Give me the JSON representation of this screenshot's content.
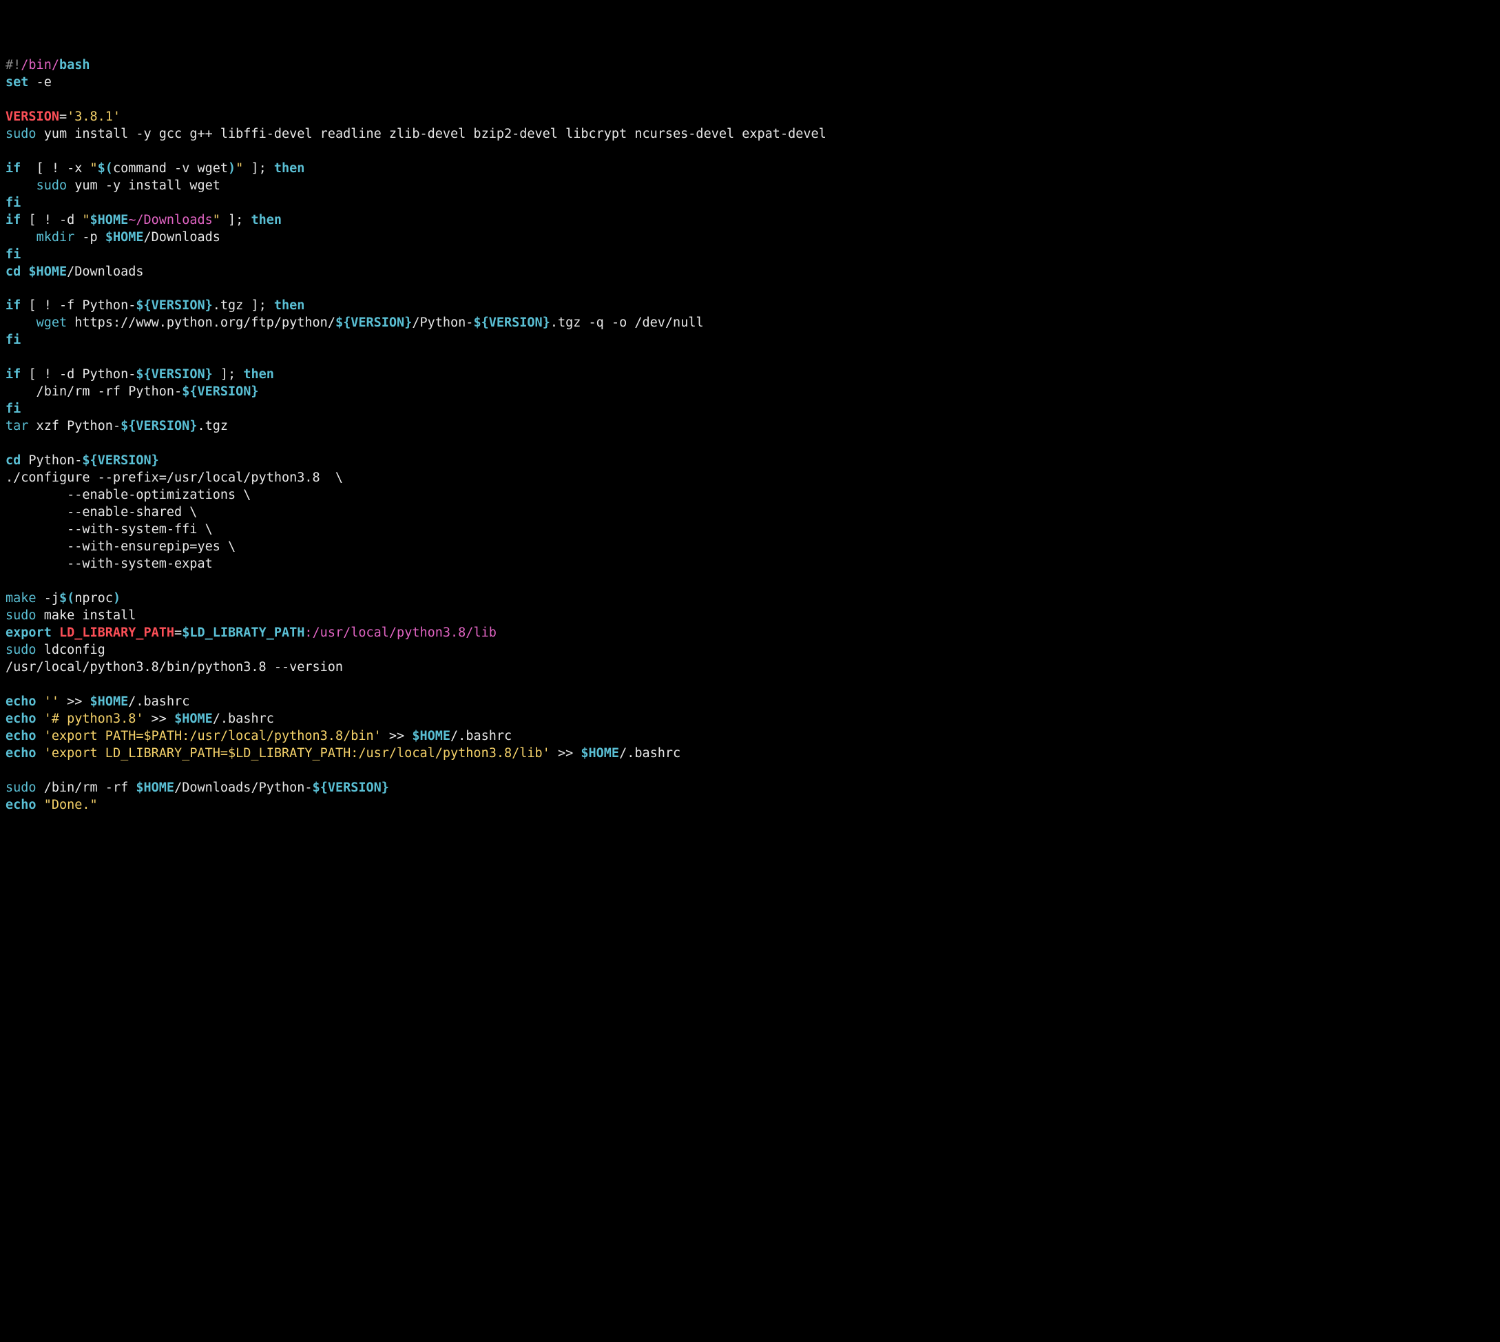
{
  "tokens": [
    {
      "c": "shebang",
      "t": "#!"
    },
    {
      "c": "path",
      "t": "/bin/"
    },
    {
      "c": "cmd bold",
      "t": "bash"
    },
    {
      "nl": true
    },
    {
      "c": "cmd bold",
      "t": "set"
    },
    {
      "c": "arg",
      "t": " -e"
    },
    {
      "nl": true
    },
    {
      "nl": true
    },
    {
      "c": "red bold",
      "t": "VERSION"
    },
    {
      "c": "arg",
      "t": "="
    },
    {
      "c": "str",
      "t": "'3.8.1'"
    },
    {
      "nl": true
    },
    {
      "c": "cmd",
      "t": "sudo"
    },
    {
      "c": "arg",
      "t": " yum install -y gcc g++ libffi-devel readline zlib-devel bzip2-devel libcrypt ncurses-devel expat-devel"
    },
    {
      "nl": true
    },
    {
      "nl": true
    },
    {
      "c": "kw bold",
      "t": "if"
    },
    {
      "c": "arg",
      "t": "  [ ! -x "
    },
    {
      "c": "str",
      "t": "\""
    },
    {
      "c": "var bold",
      "t": "$("
    },
    {
      "c": "arg",
      "t": "command -v wget"
    },
    {
      "c": "var bold",
      "t": ")"
    },
    {
      "c": "str",
      "t": "\""
    },
    {
      "c": "arg",
      "t": " ]; "
    },
    {
      "c": "kw bold",
      "t": "then"
    },
    {
      "nl": true
    },
    {
      "c": "arg",
      "t": "    "
    },
    {
      "c": "cmd",
      "t": "sudo"
    },
    {
      "c": "arg",
      "t": " yum -y install wget"
    },
    {
      "nl": true
    },
    {
      "c": "kw bold",
      "t": "fi"
    },
    {
      "nl": true
    },
    {
      "c": "kw bold",
      "t": "if"
    },
    {
      "c": "arg",
      "t": " [ ! -d "
    },
    {
      "c": "str",
      "t": "\""
    },
    {
      "c": "var bold",
      "t": "$HOME"
    },
    {
      "c": "path",
      "t": "~/Downloads"
    },
    {
      "c": "str",
      "t": "\""
    },
    {
      "c": "arg",
      "t": " ]; "
    },
    {
      "c": "kw bold",
      "t": "then"
    },
    {
      "nl": true
    },
    {
      "c": "arg",
      "t": "    "
    },
    {
      "c": "cmd",
      "t": "mkdir"
    },
    {
      "c": "arg",
      "t": " -p "
    },
    {
      "c": "var bold",
      "t": "$HOME"
    },
    {
      "c": "arg",
      "t": "/Downloads"
    },
    {
      "nl": true
    },
    {
      "c": "kw bold",
      "t": "fi"
    },
    {
      "nl": true
    },
    {
      "c": "cmd bold",
      "t": "cd"
    },
    {
      "c": "arg",
      "t": " "
    },
    {
      "c": "var bold",
      "t": "$HOME"
    },
    {
      "c": "arg",
      "t": "/Downloads"
    },
    {
      "nl": true
    },
    {
      "nl": true
    },
    {
      "c": "kw bold",
      "t": "if"
    },
    {
      "c": "arg",
      "t": " [ ! -f Python-"
    },
    {
      "c": "var bold",
      "t": "${VERSION}"
    },
    {
      "c": "arg",
      "t": ".tgz ]; "
    },
    {
      "c": "kw bold",
      "t": "then"
    },
    {
      "nl": true
    },
    {
      "c": "arg",
      "t": "    "
    },
    {
      "c": "cmd",
      "t": "wget"
    },
    {
      "c": "arg",
      "t": " https://www.python.org/ftp/python/"
    },
    {
      "c": "var bold",
      "t": "${VERSION}"
    },
    {
      "c": "arg",
      "t": "/Python-"
    },
    {
      "c": "var bold",
      "t": "${VERSION}"
    },
    {
      "c": "arg",
      "t": ".tgz -q -o /dev/null"
    },
    {
      "nl": true
    },
    {
      "c": "kw bold",
      "t": "fi"
    },
    {
      "nl": true
    },
    {
      "nl": true
    },
    {
      "c": "kw bold",
      "t": "if"
    },
    {
      "c": "arg",
      "t": " [ ! -d Python-"
    },
    {
      "c": "var bold",
      "t": "${VERSION}"
    },
    {
      "c": "arg",
      "t": " ]; "
    },
    {
      "c": "kw bold",
      "t": "then"
    },
    {
      "nl": true
    },
    {
      "c": "arg",
      "t": "    /bin/rm -rf Python-"
    },
    {
      "c": "var bold",
      "t": "${VERSION}"
    },
    {
      "nl": true
    },
    {
      "c": "kw bold",
      "t": "fi"
    },
    {
      "nl": true
    },
    {
      "c": "cmd",
      "t": "tar"
    },
    {
      "c": "arg",
      "t": " xzf Python-"
    },
    {
      "c": "var bold",
      "t": "${VERSION}"
    },
    {
      "c": "arg",
      "t": ".tgz"
    },
    {
      "nl": true
    },
    {
      "nl": true
    },
    {
      "c": "cmd bold",
      "t": "cd"
    },
    {
      "c": "arg",
      "t": " Python-"
    },
    {
      "c": "var bold",
      "t": "${VERSION}"
    },
    {
      "nl": true
    },
    {
      "c": "arg",
      "t": "./configure --prefix=/usr/local/python3.8  \\"
    },
    {
      "nl": true
    },
    {
      "c": "arg",
      "t": "        --enable-optimizations \\"
    },
    {
      "nl": true
    },
    {
      "c": "arg",
      "t": "        --enable-shared \\"
    },
    {
      "nl": true
    },
    {
      "c": "arg",
      "t": "        --with-system-ffi \\"
    },
    {
      "nl": true
    },
    {
      "c": "arg",
      "t": "        --with-ensurepip=yes \\"
    },
    {
      "nl": true
    },
    {
      "c": "arg",
      "t": "        --with-system-expat"
    },
    {
      "nl": true
    },
    {
      "nl": true
    },
    {
      "c": "cmd",
      "t": "make"
    },
    {
      "c": "arg",
      "t": " -j"
    },
    {
      "c": "var bold",
      "t": "$("
    },
    {
      "c": "arg",
      "t": "nproc"
    },
    {
      "c": "var bold",
      "t": ")"
    },
    {
      "nl": true
    },
    {
      "c": "cmd",
      "t": "sudo"
    },
    {
      "c": "arg",
      "t": " make install"
    },
    {
      "nl": true
    },
    {
      "c": "cmd bold",
      "t": "export"
    },
    {
      "c": "arg",
      "t": " "
    },
    {
      "c": "red bold",
      "t": "LD_LIBRARY_PATH"
    },
    {
      "c": "arg",
      "t": "="
    },
    {
      "c": "var bold",
      "t": "$LD_LIBRATY_PATH"
    },
    {
      "c": "path",
      "t": ":/usr/local/python3.8/lib"
    },
    {
      "nl": true
    },
    {
      "c": "cmd",
      "t": "sudo"
    },
    {
      "c": "arg",
      "t": " ldconfig"
    },
    {
      "nl": true
    },
    {
      "c": "arg",
      "t": "/usr/local/python3.8/bin/python3.8 --version"
    },
    {
      "nl": true
    },
    {
      "nl": true
    },
    {
      "c": "cmd bold",
      "t": "echo"
    },
    {
      "c": "arg",
      "t": " "
    },
    {
      "c": "str",
      "t": "''"
    },
    {
      "c": "arg",
      "t": " >> "
    },
    {
      "c": "var bold",
      "t": "$HOME"
    },
    {
      "c": "arg",
      "t": "/.bashrc"
    },
    {
      "nl": true
    },
    {
      "c": "cmd bold",
      "t": "echo"
    },
    {
      "c": "arg",
      "t": " "
    },
    {
      "c": "str",
      "t": "'# python3.8'"
    },
    {
      "c": "arg",
      "t": " >> "
    },
    {
      "c": "var bold",
      "t": "$HOME"
    },
    {
      "c": "arg",
      "t": "/.bashrc"
    },
    {
      "nl": true
    },
    {
      "c": "cmd bold",
      "t": "echo"
    },
    {
      "c": "arg",
      "t": " "
    },
    {
      "c": "str",
      "t": "'export PATH=$PATH:/usr/local/python3.8/bin'"
    },
    {
      "c": "arg",
      "t": " >> "
    },
    {
      "c": "var bold",
      "t": "$HOME"
    },
    {
      "c": "arg",
      "t": "/.bashrc"
    },
    {
      "nl": true
    },
    {
      "c": "cmd bold",
      "t": "echo"
    },
    {
      "c": "arg",
      "t": " "
    },
    {
      "c": "str",
      "t": "'export LD_LIBRARY_PATH=$LD_LIBRATY_PATH:/usr/local/python3.8/lib'"
    },
    {
      "c": "arg",
      "t": " >> "
    },
    {
      "c": "var bold",
      "t": "$HOME"
    },
    {
      "c": "arg",
      "t": "/.bashrc"
    },
    {
      "nl": true
    },
    {
      "nl": true
    },
    {
      "c": "cmd",
      "t": "sudo"
    },
    {
      "c": "arg",
      "t": " /bin/rm -rf "
    },
    {
      "c": "var bold",
      "t": "$HOME"
    },
    {
      "c": "arg",
      "t": "/Downloads/Python-"
    },
    {
      "c": "var bold",
      "t": "${VERSION}"
    },
    {
      "nl": true
    },
    {
      "c": "cmd bold",
      "t": "echo"
    },
    {
      "c": "arg",
      "t": " "
    },
    {
      "c": "str",
      "t": "\"Done.\""
    },
    {
      "nl": true
    }
  ]
}
